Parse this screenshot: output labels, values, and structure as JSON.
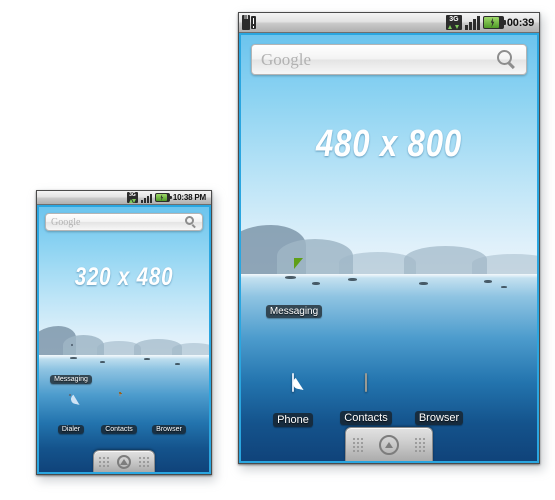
{
  "page": {
    "background": "#ffffff",
    "description": "Comparison of two Android home screens at different screen resolutions"
  },
  "devices": [
    {
      "id": "small",
      "name": "small-device",
      "resolution_label": "320 x 480",
      "status_bar": {
        "clock": "10:38 PM",
        "left_icons": [],
        "right_icons": [
          "3g-icon",
          "signal-icon",
          "battery-icon"
        ],
        "network_label": "3G"
      },
      "search_widget": {
        "placeholder": "Google",
        "icon": "search-icon"
      },
      "icons_middle": [
        {
          "label": "Messaging",
          "icon": "messaging-icon"
        }
      ],
      "icons_bottom": [
        {
          "label": "Dialer",
          "icon": "dialer-icon"
        },
        {
          "label": "Contacts",
          "icon": "contacts-icon"
        },
        {
          "label": "Browser",
          "icon": "browser-icon"
        }
      ],
      "drawer": {
        "icon": "up-arrow-icon",
        "label": ""
      }
    },
    {
      "id": "large",
      "name": "large-device",
      "resolution_label": "480 x 800",
      "status_bar": {
        "clock": "00:39",
        "left_icons": [
          "sd-card-icon"
        ],
        "right_icons": [
          "3g-icon",
          "signal-icon",
          "battery-icon"
        ],
        "network_label": "3G"
      },
      "search_widget": {
        "placeholder": "Google",
        "icon": "search-icon"
      },
      "icons_middle": [
        {
          "label": "Messaging",
          "icon": "messaging-icon"
        }
      ],
      "icons_bottom": [
        {
          "label": "Phone",
          "icon": "phone-icon"
        },
        {
          "label": "Contacts",
          "icon": "contacts-icon"
        },
        {
          "label": "Browser",
          "icon": "browser-icon"
        }
      ],
      "drawer": {
        "icon": "up-arrow-icon",
        "label": ""
      }
    }
  ],
  "colors": {
    "screen_border": "#2aa6e0",
    "bezel": "#4b4b4b",
    "sky_top": "#6cc4ee",
    "water_bottom": "#10437a",
    "messaging_green": "#7bbd2a",
    "phone_blue": "#356fbf",
    "label_background": "#181c20"
  }
}
